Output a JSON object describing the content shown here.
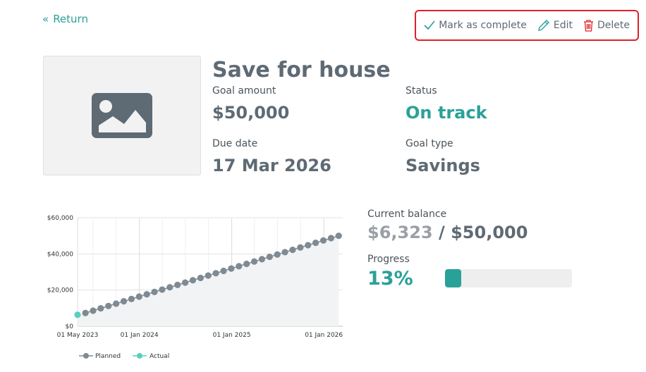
{
  "nav": {
    "return_label": "Return"
  },
  "actions": {
    "mark_complete": "Mark as complete",
    "edit": "Edit",
    "delete": "Delete",
    "highlight_color": "#e0202b"
  },
  "goal": {
    "title": "Save for house",
    "image_icon": "image-placeholder-icon",
    "goal_amount_label": "Goal amount",
    "goal_amount": "$50,000",
    "status_label": "Status",
    "status": "On track",
    "due_date_label": "Due date",
    "due_date": "17 Mar 2026",
    "goal_type_label": "Goal type",
    "goal_type": "Savings"
  },
  "balance": {
    "label": "Current balance",
    "current": "$6,323",
    "separator": " / ",
    "target": "$50,000"
  },
  "progress": {
    "label": "Progress",
    "percent_text": "13%",
    "fraction": 0.13
  },
  "colors": {
    "accent": "#2aa198",
    "planned": "#7f8a93",
    "actual": "#5ccdbf"
  },
  "chart_data": {
    "type": "line",
    "title": "",
    "xlabel": "",
    "ylabel": "",
    "ylim": [
      0,
      60000
    ],
    "y_ticks": [
      "$0",
      "$20,000",
      "$40,000",
      "$60,000"
    ],
    "y_tick_values": [
      0,
      20000,
      40000,
      60000
    ],
    "x_ticks": [
      "01 May 2023",
      "01 Jan 2024",
      "01 Jan 2025",
      "01 Jan 2026"
    ],
    "x_tick_dates": [
      "2023-05-01",
      "2024-01-01",
      "2025-01-01",
      "2026-01-01"
    ],
    "xlim": [
      "2023-05-01",
      "2026-03-17"
    ],
    "grid": true,
    "legend": "bottom",
    "series": [
      {
        "name": "Planned",
        "color": "#7f8a93",
        "start": "2023-06-01",
        "end": "2026-03-01",
        "points": 34,
        "y_start": 7300,
        "y_end": 50000
      },
      {
        "name": "Actual",
        "color": "#5ccdbf",
        "x": [
          "2023-05-01"
        ],
        "y": [
          6323
        ]
      }
    ]
  }
}
